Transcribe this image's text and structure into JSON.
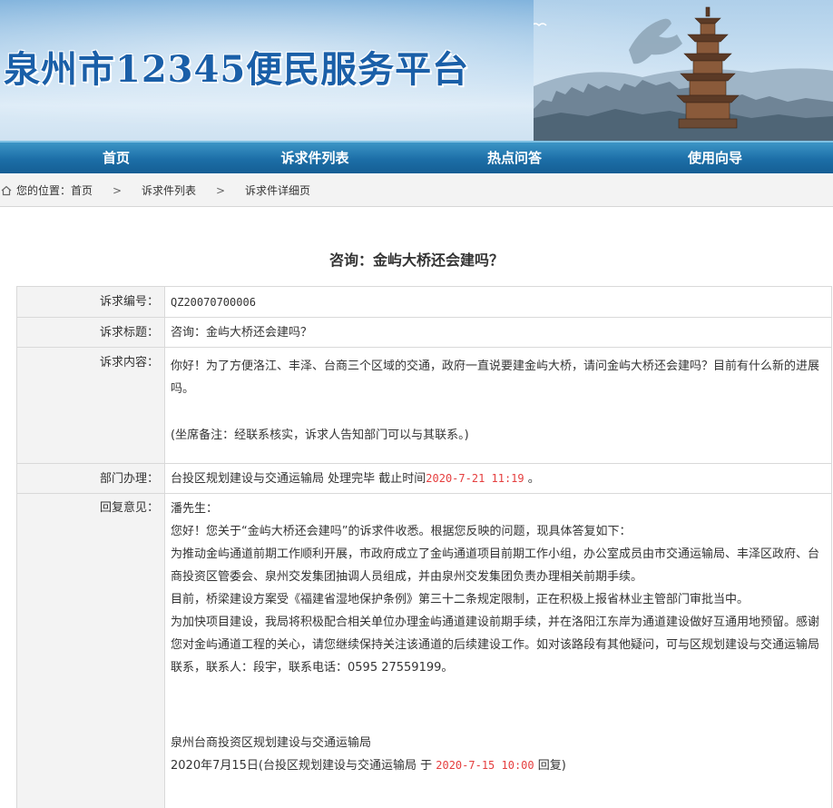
{
  "header": {
    "title": "泉州市12345便民服务平台"
  },
  "nav": {
    "items": [
      "首页",
      "诉求件列表",
      "热点问答",
      "使用向导"
    ]
  },
  "breadcrumb": {
    "prefix": "您的位置：",
    "items": [
      "首页",
      "诉求件列表",
      "诉求件详细页"
    ],
    "separator": ">"
  },
  "page": {
    "title": "咨询：金屿大桥还会建吗？"
  },
  "detail": {
    "number_label": "诉求编号：",
    "number": "QZ20070700006",
    "subject_label": "诉求标题：",
    "subject": "咨询：金屿大桥还会建吗？",
    "content_label": "诉求内容：",
    "content": "你好！为了方便洛江、丰泽、台商三个区域的交通，政府一直说要建金屿大桥，请问金屿大桥还会建吗？目前有什么新的进展吗。",
    "content_note": "(坐席备注：经联系核实，诉求人告知部门可以与其联系。)",
    "dept_label": "部门办理：",
    "dept_text": "台投区规划建设与交通运输局 处理完毕   截止时间",
    "dept_deadline": "2020-7-21 11:19",
    "dept_suffix": "。",
    "reply_label": "回复意见：",
    "reply_lines": [
      "潘先生：",
      "您好！您关于“金屿大桥还会建吗”的诉求件收悉。根据您反映的问题，现具体答复如下：",
      "为推动金屿通道前期工作顺利开展，市政府成立了金屿通道项目前期工作小组，办公室成员由市交通运输局、丰泽区政府、台商投资区管委会、泉州交发集团抽调人员组成，并由泉州交发集团负责办理相关前期手续。",
      "目前，桥梁建设方案受《福建省湿地保护条例》第三十二条规定限制，正在积极上报省林业主管部门审批当中。",
      "为加快项目建设，我局将积极配合相关单位办理金屿通道建设前期手续，并在洛阳江东岸为通道建设做好互通用地预留。感谢您对金屿通道工程的关心，请您继续保持关注该通道的后续建设工作。如对该路段有其他疑问，可与区规划建设与交通运输局联系，联系人：段宇，联系电话：0595 27559199。"
    ],
    "reply_signature": "泉州台商投资区规划建设与交通运输局",
    "reply_date_prefix": "2020年7月15日(台投区规划建设与交通运输局 于",
    "reply_time": "2020-7-15 10:00",
    "reply_date_suffix": "回复)"
  },
  "colors": {
    "nav": "#1c6ea7",
    "title_blue": "#1a5fa8",
    "highlight_red": "#e53e3e",
    "label_bg": "#f3f3f3"
  }
}
